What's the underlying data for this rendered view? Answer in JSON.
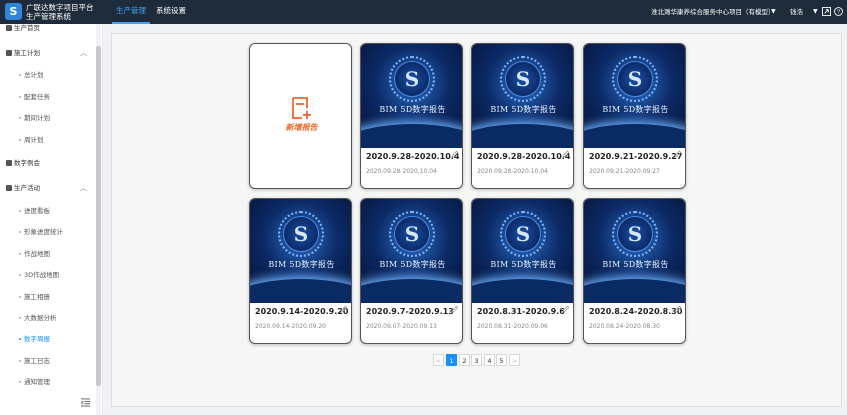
{
  "header": {
    "logo_letter": "S",
    "brand_line1": "广联达数字项目平台",
    "brand_line2": "生产管理系统",
    "tabs": [
      {
        "label": "生产管理",
        "active": true
      },
      {
        "label": "系统设置",
        "active": false
      }
    ],
    "project": "淮北濉华康养综合服务中心项目（有模型）",
    "user": "钱浩",
    "icons": [
      "caret-down-icon",
      "fullscreen-icon",
      "help-icon"
    ]
  },
  "sidebar": {
    "home": "生产首页",
    "groups": [
      {
        "label": "施工计划",
        "icon": "bar-chart-icon",
        "items": [
          "总计划",
          "配套任务",
          "期间计划",
          "周计划"
        ]
      },
      {
        "label": "数字例会",
        "icon": "meeting-icon",
        "items": []
      },
      {
        "label": "生产活动",
        "icon": "grid-icon",
        "items": [
          "进度看板",
          "形象进度统计",
          "作战地图",
          "3D作战地图",
          "施工相册",
          "大数据分析",
          "数字周报",
          "施工日志",
          "通知管理"
        ]
      }
    ],
    "active_item": "数字周报",
    "collapse_icon": "menu-fold-icon"
  },
  "reports": {
    "add_label": "新增报告",
    "cover_title": "BIM 5D数字报告",
    "cards": [
      {
        "title": "2020.9.28-2020.10.4",
        "date": "2020.09.28-2020.10.04"
      },
      {
        "title": "2020.9.28-2020.10.4",
        "date": "2020.09.28-2020.10.04"
      },
      {
        "title": "2020.9.21-2020.9.27",
        "date": "2020.09.21-2020.09.27"
      },
      {
        "title": "2020.9.14-2020.9.20",
        "date": "2020.09.14-2020.09.20"
      },
      {
        "title": "2020.9.7-2020.9.13",
        "date": "2020.09.07-2020.09.13"
      },
      {
        "title": "2020.8.31-2020.9.6",
        "date": "2020.08.31-2020.09.06"
      },
      {
        "title": "2020.8.24-2020.8.30",
        "date": "2020.08.24-2020.08.30"
      }
    ]
  },
  "pagination": {
    "prev": "<",
    "next": ">",
    "pages": [
      "1",
      "2",
      "3",
      "4",
      "5"
    ],
    "current": "1"
  },
  "colors": {
    "accent": "#1890ff",
    "header_bg": "#1d2b3a",
    "add_orange": "#f0672c"
  }
}
